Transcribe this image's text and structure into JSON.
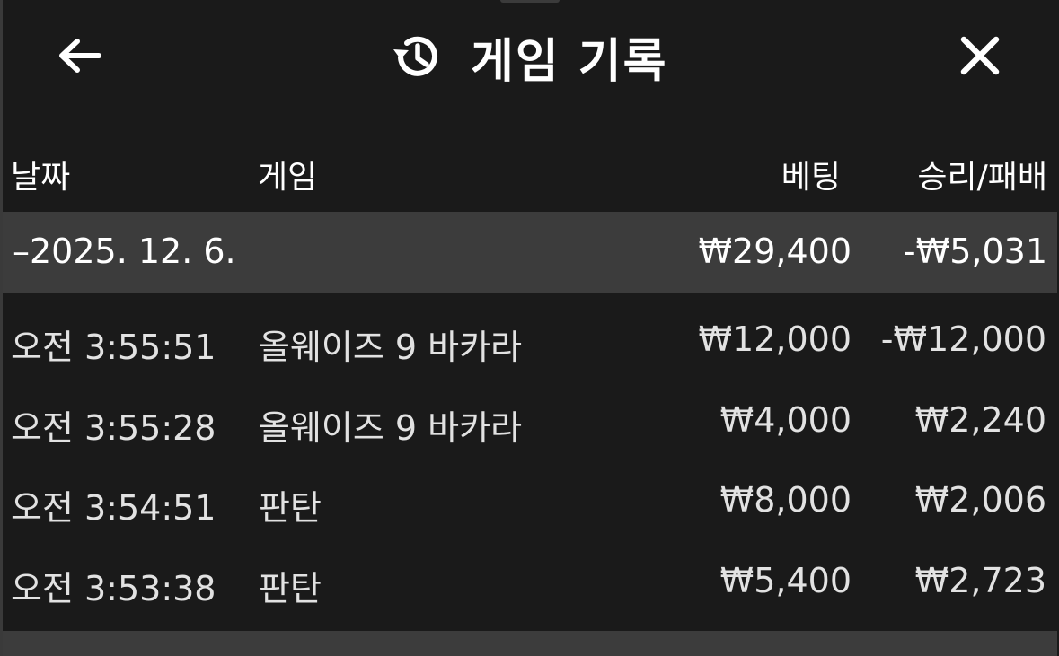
{
  "header": {
    "title": "게임 기록",
    "back_icon": "arrow-left-icon",
    "history_icon": "history-icon",
    "close_icon": "close-icon"
  },
  "columns": {
    "date": "날짜",
    "game": "게임",
    "bet": "베팅",
    "win_loss": "승리/패배"
  },
  "group": {
    "date": "–2025. 12. 6.",
    "bet_total": "₩29,400",
    "win_loss_total": "-₩5,031"
  },
  "rows": [
    {
      "time": "오전 3:55:51",
      "game": "올웨이즈 9 바카라",
      "bet": "₩12,000",
      "win_loss": "-₩12,000"
    },
    {
      "time": "오전 3:55:28",
      "game": "올웨이즈 9 바카라",
      "bet": "₩4,000",
      "win_loss": "₩2,240"
    },
    {
      "time": "오전 3:54:51",
      "game": "판탄",
      "bet": "₩8,000",
      "win_loss": "₩2,006"
    },
    {
      "time": "오전 3:53:38",
      "game": "판탄",
      "bet": "₩5,400",
      "win_loss": "₩2,723"
    }
  ],
  "colors": {
    "background": "#1a1a1a",
    "group_row": "#3c3c3c",
    "text": "#e2e2e2"
  }
}
